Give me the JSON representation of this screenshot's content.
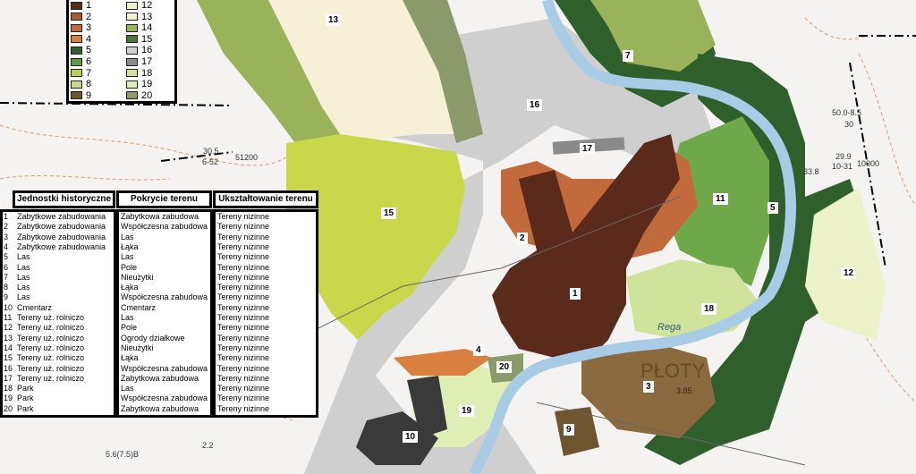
{
  "legend": {
    "items": [
      {
        "num": "1",
        "color": "#5a2a1a"
      },
      {
        "num": "2",
        "color": "#a9592c"
      },
      {
        "num": "3",
        "color": "#c26a3c"
      },
      {
        "num": "4",
        "color": "#d9803f"
      },
      {
        "num": "5",
        "color": "#2f5f2a"
      },
      {
        "num": "6",
        "color": "#5f9a45"
      },
      {
        "num": "7",
        "color": "#b9d050"
      },
      {
        "num": "8",
        "color": "#c8d892"
      },
      {
        "num": "9",
        "color": "#6e5530"
      },
      {
        "num": "12",
        "color": "#eef2c8"
      },
      {
        "num": "13",
        "color": "#f5f0d6"
      },
      {
        "num": "14",
        "color": "#9ab25a"
      },
      {
        "num": "15",
        "color": "#47783a"
      },
      {
        "num": "16",
        "color": "#cfcfcf"
      },
      {
        "num": "17",
        "color": "#8a8a8a"
      },
      {
        "num": "18",
        "color": "#cfe39a"
      },
      {
        "num": "19",
        "color": "#dfeeb4"
      },
      {
        "num": "20",
        "color": "#8a9a6a"
      }
    ]
  },
  "table": {
    "headers": [
      "Jednostki historyczne",
      "Pokrycie terenu",
      "Ukształtowanie terenu"
    ],
    "rows": [
      [
        "1",
        "Zabytkowe zabudowania",
        "Zabytkowa zabudowa",
        "Tereny nizinne"
      ],
      [
        "2",
        "Zabytkowe zabudowania",
        "Współczesna zabudowa",
        "Tereny nizinne"
      ],
      [
        "3",
        "Zabytkowe zabudowania",
        "Las",
        "Tereny nizinne"
      ],
      [
        "4",
        "Zabytkowe zabudowania",
        "Łąka",
        "Tereny nizinne"
      ],
      [
        "5",
        "Las",
        "Las",
        "Tereny nizinne"
      ],
      [
        "6",
        "Las",
        "Pole",
        "Tereny nizinne"
      ],
      [
        "7",
        "Las",
        "Nieużytki",
        "Tereny nizinne"
      ],
      [
        "8",
        "Las",
        "Łąka",
        "Tereny nizinne"
      ],
      [
        "9",
        "Las",
        "Współczesna zabudowa",
        "Tereny nizinne"
      ],
      [
        "10",
        "Cmentarz",
        "Cmentarz",
        "Tereny nizinne"
      ],
      [
        "11",
        "Tereny uż. rolniczo",
        "Las",
        "Tereny nizinne"
      ],
      [
        "12",
        "Tereny uż. rolniczo",
        "Pole",
        "Tereny nizinne"
      ],
      [
        "13",
        "Tereny uż. rolniczo",
        "Ogrody działkowe",
        "Tereny nizinne"
      ],
      [
        "14",
        "Tereny uż. rolniczo",
        "Nieużytki",
        "Tereny nizinne"
      ],
      [
        "15",
        "Tereny uż. rolniczo",
        "Łąka",
        "Tereny nizinne"
      ],
      [
        "16",
        "Tereny uż. rolniczo",
        "Współczesna zabudowa",
        "Tereny nizinne"
      ],
      [
        "17",
        "Tereny uż. rolniczo",
        "Zabytkowa zabudowa",
        "Tereny nizinne"
      ],
      [
        "18",
        "Park",
        "Las",
        "Tereny nizinne"
      ],
      [
        "19",
        "Park",
        "Współczesna zabudowa",
        "Tereny nizinne"
      ],
      [
        "20",
        "Park",
        "Zabytkowa zabudowa",
        "Tereny nizinne"
      ]
    ]
  },
  "map_labels": {
    "z1": "1",
    "z2": "2",
    "z3": "3",
    "z4": "4",
    "z5": "5",
    "z7": "7",
    "z9": "9",
    "z10": "10",
    "z11": "11",
    "z12": "12",
    "z13": "13",
    "z15": "15",
    "z16": "16",
    "z17": "17",
    "z18": "18",
    "z19": "19",
    "z20": "20"
  },
  "map_text": {
    "town_name": "PŁOTY",
    "river_name": "Rega",
    "elev_1": "30.5",
    "elev_2": "6-52",
    "elev_3": "51200",
    "elev_4": "50.0-8.5",
    "elev_5": "30",
    "elev_6": "29.9",
    "elev_7": "10-31",
    "elev_8": "10000",
    "elev_9": "33.8",
    "elev_10": "3.85",
    "elev_11": "2.2",
    "elev_12": "5.6(7.5)B"
  }
}
